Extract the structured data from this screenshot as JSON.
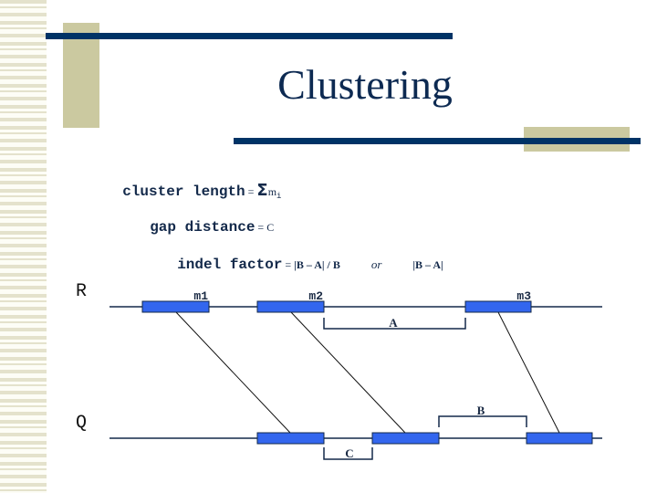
{
  "slide": {
    "title": "Clustering",
    "formulas": {
      "cluster_length": {
        "label": "cluster length",
        "eq": " = ",
        "sigma": "Σ",
        "var": "m",
        "sub": "i"
      },
      "gap_distance": {
        "label": "gap distance",
        "eq": " = ",
        "value": "C"
      },
      "indel_factor": {
        "label": "indel factor",
        "eq": " = ",
        "expr1": "|B – A| / B",
        "or": "or",
        "expr2": "|B – A|"
      }
    },
    "colors": {
      "navy": "#003366",
      "khaki": "#cbc9a0",
      "match_block": "#3366ee"
    }
  },
  "diagram": {
    "sequences": [
      {
        "name": "R",
        "blocks": [
          "m1",
          "m2",
          "m3"
        ]
      },
      {
        "name": "Q",
        "blocks": [
          "",
          "",
          ""
        ]
      }
    ],
    "block_labels": [
      "m1",
      "m2",
      "m3"
    ],
    "brackets": {
      "A": "A",
      "B": "B",
      "C": "C"
    },
    "alignments": [
      {
        "from": "m1",
        "to": "Q block 1"
      },
      {
        "from": "m2",
        "to": "Q block 2"
      },
      {
        "from": "m3",
        "to": "Q block 3"
      }
    ]
  }
}
